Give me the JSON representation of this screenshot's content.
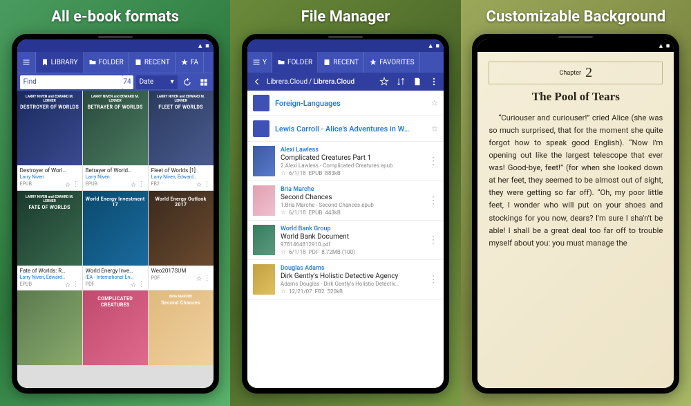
{
  "panels": {
    "p1_title": "All e-book formats",
    "p2_title": "File Manager",
    "p3_title": "Customizable Background"
  },
  "toolbar": {
    "library": "LIBRARY",
    "folder": "FOLDER",
    "recent": "RECENT",
    "favorites_short": "FA",
    "favorites": "FAVORITES",
    "y": "Y"
  },
  "search": {
    "placeholder": "Find",
    "count": "74",
    "sort": "Date"
  },
  "breadcrumb": {
    "seg1": "Librera.Cloud",
    "seg2": "Librera.Cloud"
  },
  "books": [
    {
      "cover_auth": "LARRY NIVEN and EDWARD M. LERNER",
      "cover_title": "DESTROYER OF WORLDS",
      "title": "Destroyer of Worl…",
      "author": "Larry Niven",
      "fmt": "EPUB"
    },
    {
      "cover_auth": "LARRY NIVEN and EDWARD M. LERNER",
      "cover_title": "BETRAYER OF WORLDS",
      "title": "Betrayer of World…",
      "author": "Larry Niven",
      "fmt": "EPUB"
    },
    {
      "cover_auth": "LARRY NIVEN and EDWARD M. LERNER",
      "cover_title": "FLEET OF WORLDS",
      "title": "Fleet of Worlds [1]",
      "author": "Larry Niven, Edward…",
      "fmt": "FB2"
    },
    {
      "cover_auth": "LARRY NIVEN and EDWARD M. LERNER",
      "cover_title": "FATE OF WORLDS",
      "title": "Fate of Worlds: R…",
      "author": "Larry Niven, Edward…",
      "fmt": "EPUB"
    },
    {
      "cover_auth": "",
      "cover_title": "World Energy Investment 17",
      "title": "World Energy Inve…",
      "author": "IEA - International En…",
      "fmt": "PDF"
    },
    {
      "cover_auth": "",
      "cover_title": "World Energy Outlook 2017",
      "title": "Weo2017SUM",
      "author": "",
      "fmt": "PDF"
    },
    {
      "cover_auth": "",
      "cover_title": "",
      "title": "",
      "author": "",
      "fmt": ""
    },
    {
      "cover_auth": "",
      "cover_title": "COMPLICATED CREATURES",
      "title": "",
      "author": "",
      "fmt": ""
    },
    {
      "cover_auth": "BRIA MARCHE",
      "cover_title": "Second Chances",
      "title": "",
      "author": "",
      "fmt": ""
    }
  ],
  "folders": [
    {
      "name": "Foreign-Languages"
    },
    {
      "name": "Lewis Carroll -  Alice's Adventures in W…"
    }
  ],
  "files": [
    {
      "author": "Alexi Lawless",
      "title": "Complicated Creatures Part 1",
      "sub": "2.Alexi Lawless - Complicated Creatures.epub",
      "date": "6/1/18",
      "fmt": "EPUB",
      "size": "883kB"
    },
    {
      "author": "Bria Marche",
      "title": "Second Chances",
      "sub": "1.Bria Marche - Second Chances.epub",
      "date": "6/1/18",
      "fmt": "EPUB",
      "size": "443kB"
    },
    {
      "author": "World Bank Group",
      "title": "World Bank Document",
      "sub": "9781464812910.pdf",
      "date": "6/1/18",
      "fmt": "PDF",
      "size": "8.72MB (100)"
    },
    {
      "author": "Douglas Adams",
      "title": "Dirk Gently's Holistic Detective Agency",
      "sub": "Adams Douglas - Dirk Gently's Holistic Detectiv…",
      "date": "12/21/07",
      "fmt": "FB2",
      "size": "520kB"
    }
  ],
  "reader": {
    "chapter_label": "Chapter",
    "chapter_num": "2",
    "title": "The Pool of Tears",
    "body": "“Curiouser and curiouser!” cried Alice (she was so much surprised, that for the moment she quite forgot how to speak good English). “Now I'm opening out like the largest telescope that ever was! Good-bye, feet!” (for when she looked down at her feet, they seemed to be almost out of sight, they were getting so far off). “Oh, my poor little feet, I wonder who will put on your shoes and stockings for you now, dears? I'm sure I sha'n't be able! I shall be a great deal too far off to trouble myself about you: you must manage the"
  }
}
